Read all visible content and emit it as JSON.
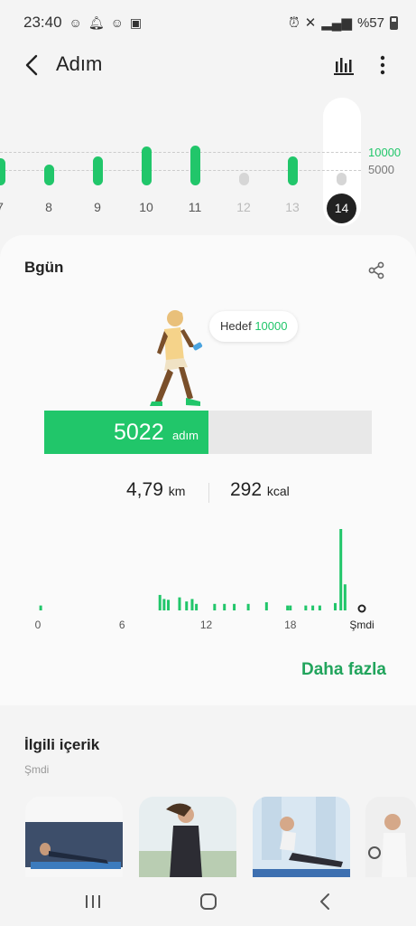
{
  "status": {
    "time": "23:40",
    "battery": "%57"
  },
  "header": {
    "title": "Adım"
  },
  "week": {
    "days": [
      {
        "label": "7",
        "steps": 6500,
        "color": "green",
        "dim": false
      },
      {
        "label": "8",
        "steps": 5000,
        "color": "green",
        "dim": false
      },
      {
        "label": "9",
        "steps": 7000,
        "color": "green",
        "dim": false
      },
      {
        "label": "10",
        "steps": 9300,
        "color": "green",
        "dim": false
      },
      {
        "label": "11",
        "steps": 9500,
        "color": "green",
        "dim": false
      },
      {
        "label": "12",
        "steps": 2000,
        "color": "gray",
        "dim": true
      },
      {
        "label": "13",
        "steps": 7000,
        "color": "green",
        "dim": true
      },
      {
        "label": "14",
        "steps": 1500,
        "color": "gray",
        "dim": false
      }
    ],
    "goal_label": "10000",
    "half_label": "5000",
    "selected": "14"
  },
  "today": {
    "title": "Bgün",
    "goal_label": "Hedef",
    "goal_value": "10000",
    "steps": "5022",
    "steps_unit": "adım",
    "progress": 0.5022,
    "distance": "4,79",
    "distance_unit": "km",
    "calories": "292",
    "calories_unit": "kcal",
    "hourly_axis": [
      "0",
      "6",
      "12",
      "18",
      "Şmdi"
    ],
    "more": "Daha fazla"
  },
  "chart_data": {
    "type": "bar",
    "x": [
      0.2,
      8.7,
      9.0,
      9.3,
      10.1,
      10.6,
      11.0,
      11.3,
      12.6,
      13.3,
      14.0,
      15.0,
      16.3,
      17.8,
      18.0,
      19.1,
      19.6,
      20.1,
      21.2,
      21.6,
      21.9
    ],
    "values": [
      0.06,
      0.19,
      0.14,
      0.13,
      0.16,
      0.11,
      0.14,
      0.08,
      0.08,
      0.08,
      0.08,
      0.08,
      0.1,
      0.06,
      0.06,
      0.06,
      0.06,
      0.06,
      0.09,
      1.0,
      0.32
    ],
    "xlim": [
      0,
      24
    ],
    "x_tick_labels": [
      "0",
      "6",
      "12",
      "18",
      "Şmdi"
    ]
  },
  "related": {
    "title": "İlgili içerik",
    "subtitle": "Şmdi"
  },
  "colors": {
    "accent": "#21c66a",
    "link": "#21a45c",
    "selected": "#222222",
    "inactive": "#d6d6d6"
  }
}
